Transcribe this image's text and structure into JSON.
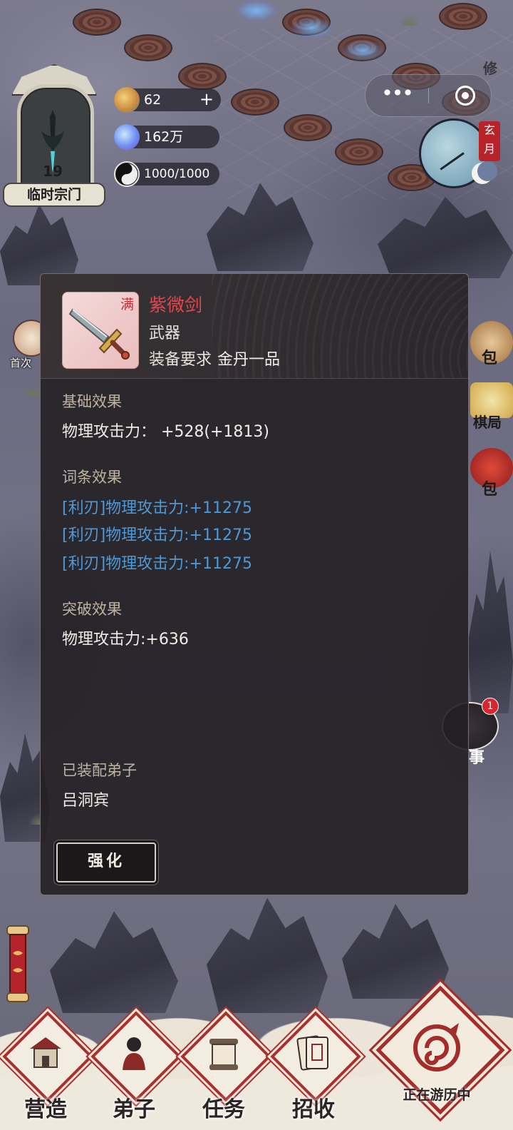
{
  "sect": {
    "level": "19",
    "name": "临时宗门"
  },
  "resources": [
    {
      "icon": "spirit-orb-icon",
      "value": "62",
      "plus": "+"
    },
    {
      "icon": "crystal-icon",
      "value": "162万"
    },
    {
      "icon": "yin-yang-icon",
      "value": "1000/1000"
    }
  ],
  "capsule": {
    "more": "•••"
  },
  "time": {
    "tag": "玄月"
  },
  "side": {
    "first_recharge": "首次",
    "bag_right_1": "包",
    "chess_right": "棋局",
    "bag_right_2": "包",
    "story_right": "事",
    "notify_count": "1",
    "top_right_text": "修"
  },
  "item": {
    "full_tag": "满",
    "name": "紫微剑",
    "type": "武器",
    "req_label": "装备要求",
    "req_value": "金丹一品",
    "base_title": "基础效果",
    "base_line": "物理攻击力：  +528(+1813)",
    "affix_title": "词条效果",
    "affixes": [
      "[利刃]物理攻击力:+11275",
      "[利刃]物理攻击力:+11275",
      "[利刃]物理攻击力:+11275"
    ],
    "break_title": "突破效果",
    "break_line": "物理攻击力:+636",
    "equipped_title": "已装配弟子",
    "equipped_name": "吕洞宾",
    "enhance_label": "强化"
  },
  "colors": {
    "item_name": "#e2474f",
    "affix": "#4d98d8",
    "accent_red": "#a8312e"
  },
  "nav": [
    {
      "label": "营造",
      "icon": "building-icon"
    },
    {
      "label": "弟子",
      "icon": "disciple-icon"
    },
    {
      "label": "任务",
      "icon": "scroll-task-icon"
    },
    {
      "label": "招收",
      "icon": "recruit-card-icon"
    }
  ],
  "travel": {
    "label": "正在游历中"
  }
}
